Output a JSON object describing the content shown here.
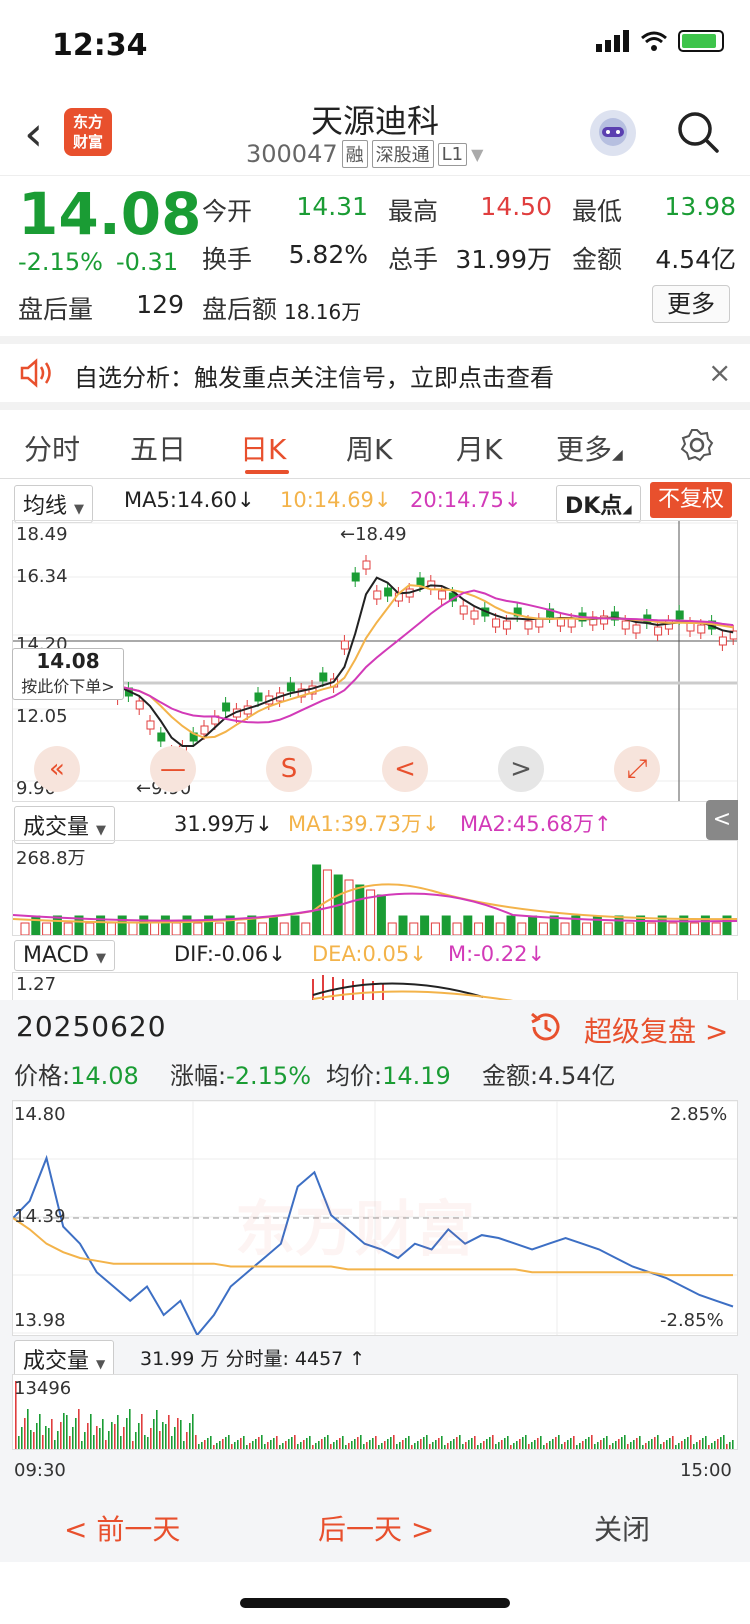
{
  "status_bar": {
    "time": "12:34"
  },
  "header": {
    "back_icon": "chevron-left-icon",
    "logo_line1": "东方",
    "logo_line2": "财富",
    "stock_name": "天源迪科",
    "stock_code": "300047",
    "tags": [
      "融",
      "深股通",
      "L1"
    ]
  },
  "quote": {
    "price": "14.08",
    "change_pct": "-2.15%",
    "change_abs": "-0.31",
    "open_label": "今开",
    "open": "14.31",
    "high_label": "最高",
    "high": "14.50",
    "low_label": "最低",
    "low": "13.98",
    "turnover_label": "换手",
    "turnover": "5.82%",
    "volume_label": "总手",
    "volume": "31.99万",
    "amount_label": "金额",
    "amount": "4.54亿",
    "after_vol_label": "盘后量",
    "after_vol": "129",
    "after_amt_label": "盘后额",
    "after_amt": "18.16万",
    "more": "更多"
  },
  "notice": {
    "text": "自选分析：触发重点关注信号，立即点击查看",
    "close": "×"
  },
  "tabs": [
    "分时",
    "五日",
    "日K",
    "周K",
    "月K",
    "更多"
  ],
  "active_tab": "日K",
  "kline": {
    "ma_select": "均线",
    "ma5": "MA5:14.60↓",
    "ma10": "10:14.69↓",
    "ma20": "20:14.75↓",
    "dk": "DK点",
    "fuquan": "不复权",
    "y_ticks": [
      "18.49",
      "16.34",
      "14.20",
      "12.05",
      "9.90"
    ],
    "max_label": "←18.49",
    "min_label": "←9.90",
    "cross_price": "14.08",
    "cross_hint": "按此价下单>",
    "vol_select": "成交量",
    "vol_total": "31.99万↓",
    "vol_ma1": "MA1:39.73万↓",
    "vol_ma2": "MA2:45.68万↑",
    "vol_max": "268.8万",
    "macd_select": "MACD",
    "dif": "DIF:-0.06↓",
    "dea": "DEA:0.05↓",
    "m": "M:-0.22↓",
    "macd_max": "1.27",
    "side_tab": "<",
    "buttons": [
      "«",
      "—",
      "S",
      "<",
      ">",
      "⤢"
    ]
  },
  "intraday": {
    "date": "20250620",
    "replay": "超级复盘 >",
    "price_label": "价格:",
    "price": "14.08",
    "chg_label": "涨幅:",
    "chg": "-2.15%",
    "avg_label": "均价:",
    "avg": "14.19",
    "amt_label": "金额:",
    "amt": "4.54亿",
    "y_top": "14.80",
    "y_mid": "14.39",
    "y_bot": "13.98",
    "pct_top": "2.85%",
    "pct_bot": "-2.85%",
    "vol_select": "成交量",
    "vol_info": "31.99 万 分时量: 4457 ↑",
    "vol_max": "13496",
    "t_start": "09:30",
    "t_end": "15:00",
    "watermark": "东方财富"
  },
  "bottom_nav": {
    "prev": "< 前一天",
    "next": "后一天 >",
    "close": "关闭"
  },
  "chart_data": [
    {
      "type": "line",
      "title": "",
      "series": [
        {
          "name": "价格",
          "values": [
            14.39,
            14.45,
            14.6,
            14.36,
            14.3,
            14.2,
            14.15,
            14.1,
            14.15,
            14.05,
            14.1,
            13.98,
            14.05,
            14.15,
            14.2,
            14.25,
            14.3,
            14.5,
            14.55,
            14.4,
            14.35,
            14.3,
            14.28,
            14.25,
            14.3,
            14.28,
            14.35,
            14.3,
            14.33,
            14.32,
            14.3,
            14.28,
            14.3,
            14.32,
            14.3,
            14.28,
            14.25,
            14.22,
            14.2,
            14.18,
            14.15,
            14.12,
            14.1,
            14.08
          ]
        },
        {
          "name": "均价",
          "values": [
            14.39,
            14.35,
            14.3,
            14.27,
            14.25,
            14.24,
            14.23,
            14.23,
            14.23,
            14.23,
            14.23,
            14.23,
            14.23,
            14.22,
            14.22,
            14.22,
            14.22,
            14.22,
            14.22,
            14.22,
            14.21,
            14.21,
            14.21,
            14.21,
            14.21,
            14.21,
            14.21,
            14.21,
            14.21,
            14.21,
            14.21,
            14.2,
            14.2,
            14.2,
            14.2,
            14.2,
            14.2,
            14.2,
            14.2,
            14.19,
            14.19,
            14.19,
            14.19,
            14.19
          ]
        }
      ],
      "ylim": [
        13.98,
        14.8
      ]
    }
  ]
}
